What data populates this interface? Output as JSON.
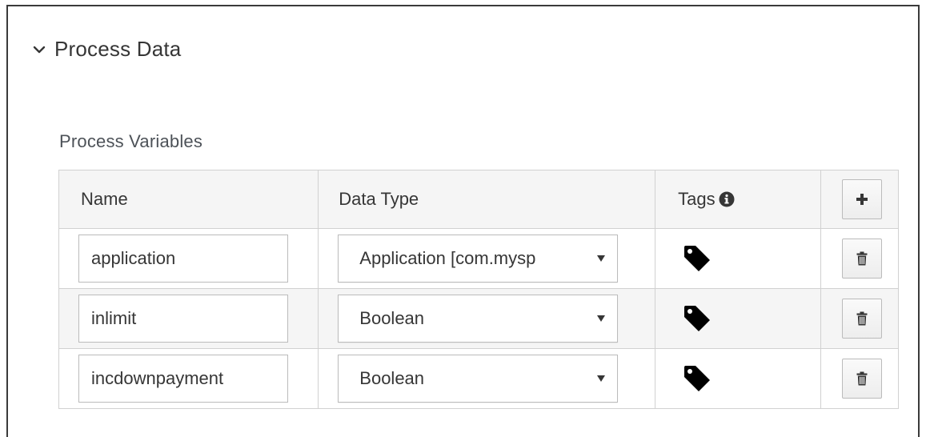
{
  "section": {
    "title": "Process Data"
  },
  "process_variables": {
    "label": "Process Variables",
    "columns": {
      "name": "Name",
      "data_type": "Data Type",
      "tags": "Tags"
    },
    "rows": [
      {
        "name": "application",
        "data_type": "Application [com.mysp"
      },
      {
        "name": "inlimit",
        "data_type": "Boolean"
      },
      {
        "name": "incdownpayment",
        "data_type": "Boolean"
      }
    ]
  },
  "icons": {
    "chevron": "chevron-down-icon",
    "info": "info-circle-icon",
    "tag": "tags-icon",
    "add": "plus-icon",
    "delete": "trash-icon"
  },
  "colors": {
    "header_bg": "#f5f5f5",
    "border": "#d1d1d1",
    "text": "#363636"
  }
}
